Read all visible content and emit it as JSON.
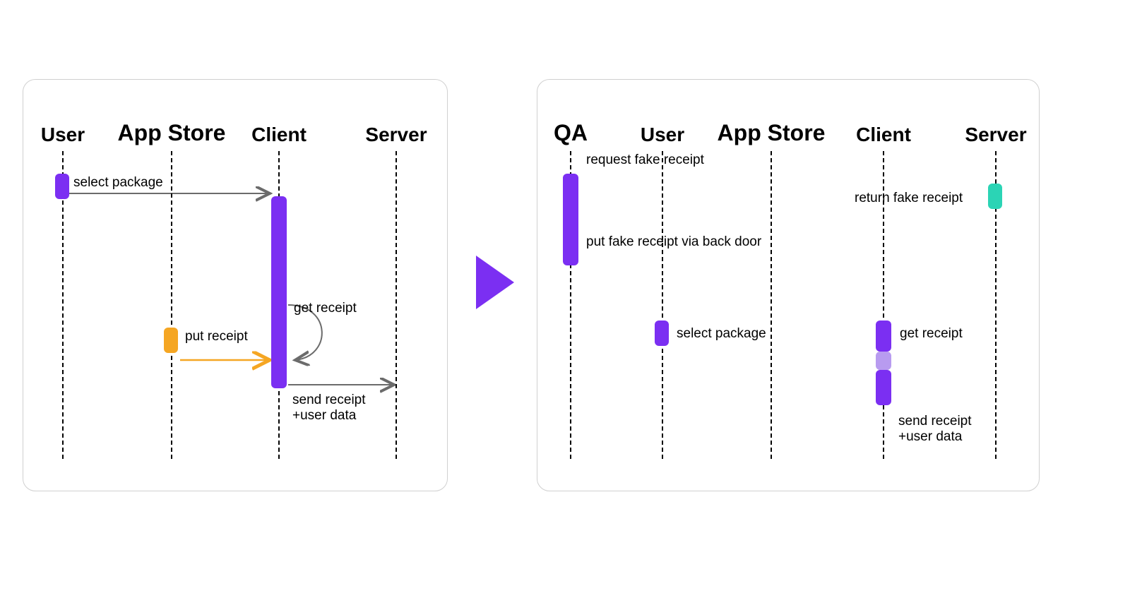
{
  "colors": {
    "purple": "#7B2FF2",
    "purple_light": "#B89BF0",
    "orange": "#F5A623",
    "teal": "#2BD4B5",
    "arrow_gray": "#6b6b6b"
  },
  "left": {
    "actors": {
      "user": "User",
      "appstore": "App Store",
      "client": "Client",
      "server": "Server"
    },
    "messages": {
      "select_package": "select package",
      "put_receipt": "put receipt",
      "get_receipt": "get receipt",
      "send_receipt": "send receipt\n+user data"
    }
  },
  "right": {
    "actors": {
      "qa": "QA",
      "user": "User",
      "appstore": "App Store",
      "client": "Client",
      "server": "Server"
    },
    "messages": {
      "request_fake": "request fake receipt",
      "return_fake": "return fake receipt",
      "put_fake_backdoor": "put fake receipt via back door",
      "select_package": "select package",
      "get_receipt": "get receipt",
      "send_receipt": "send receipt\n+user data"
    }
  }
}
